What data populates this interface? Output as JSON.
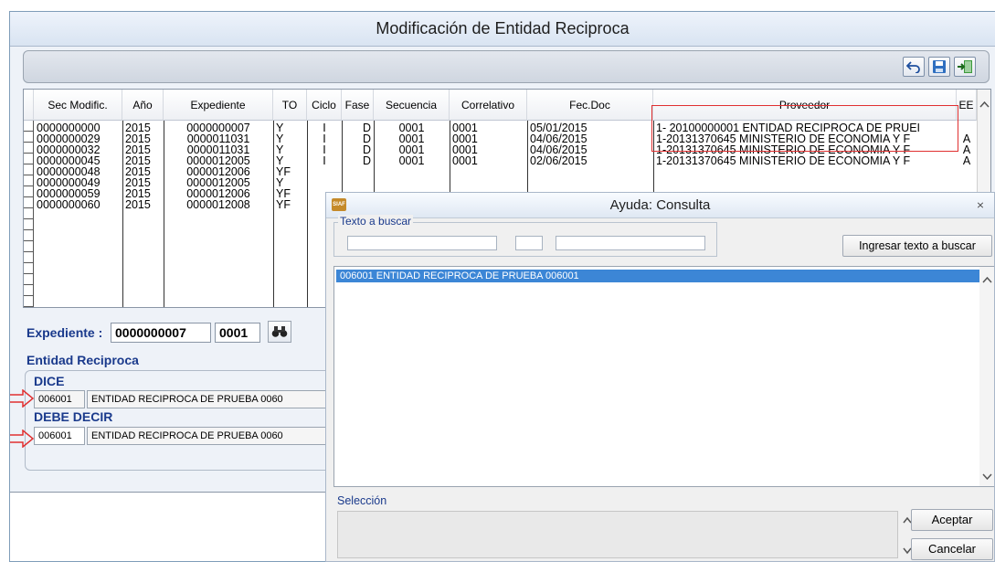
{
  "window": {
    "title": "Modificación de Entidad Reciproca"
  },
  "toolbar": {
    "undo_icon": "undo-icon",
    "save_icon": "save-icon",
    "exit_icon": "exit-icon"
  },
  "grid": {
    "columns": [
      "Sec Modific.",
      "Año",
      "Expediente",
      "TO",
      "Ciclo",
      "Fase",
      "Secuencia",
      "Correlativo",
      "Fec.Doc",
      "Proveedor",
      "EE"
    ],
    "rows": [
      [
        "0000000000",
        "2015",
        "0000000007",
        "Y",
        "I",
        "D",
        "0001",
        "0001",
        "05/01/2015",
        "1- 20100000001  ENTIDAD RECIPROCA DE PRUEI",
        ""
      ],
      [
        "0000000029",
        "2015",
        "0000011031",
        "Y",
        "I",
        "D",
        "0001",
        "0001",
        "04/06/2015",
        "1-20131370645 MINISTERIO DE ECONOMIA Y F",
        "A"
      ],
      [
        "0000000032",
        "2015",
        "0000011031",
        "Y",
        "I",
        "D",
        "0001",
        "0001",
        "04/06/2015",
        "1-20131370645 MINISTERIO DE ECONOMIA Y F",
        "A"
      ],
      [
        "0000000045",
        "2015",
        "0000012005",
        "Y",
        "I",
        "D",
        "0001",
        "0001",
        "02/06/2015",
        "1-20131370645 MINISTERIO DE ECONOMIA Y F",
        "A"
      ],
      [
        "0000000048",
        "2015",
        "0000012006",
        "YF",
        "",
        "",
        "",
        "",
        "",
        "",
        ""
      ],
      [
        "0000000049",
        "2015",
        "0000012005",
        "Y",
        "",
        "",
        "",
        "",
        "",
        "",
        ""
      ],
      [
        "0000000059",
        "2015",
        "0000012006",
        "YF",
        "",
        "",
        "",
        "",
        "",
        "",
        ""
      ],
      [
        "0000000060",
        "2015",
        "0000012008",
        "YF",
        "",
        "",
        "",
        "",
        "",
        "",
        ""
      ]
    ]
  },
  "form": {
    "expediente_label": "Expediente :",
    "expediente_value": "0000000007",
    "secuencia_value": "0001",
    "binoculars_icon": "binoculars-icon",
    "entidad_label": "Entidad Reciproca",
    "dice_label": "DICE",
    "dice_code": "006001",
    "dice_name": "ENTIDAD RECIPROCA DE PRUEBA 0060",
    "debe_label": "DEBE DECIR",
    "debe_code": "006001",
    "debe_name": "ENTIDAD RECIPROCA DE PRUEBA 0060"
  },
  "dialog": {
    "title": "Ayuda: Consulta",
    "logo_text": "SIAF",
    "close_glyph": "⨯",
    "search_legend": "Texto a buscar",
    "search_button": "Ingresar texto a buscar",
    "list_items": [
      "006001  ENTIDAD RECIPROCA DE PRUEBA 006001"
    ],
    "selection_label": "Selección",
    "accept_button": "Aceptar",
    "cancel_button": "Cancelar"
  },
  "colors": {
    "highlight_box": "#e03030",
    "selected_row": "#3c86d6",
    "label_blue": "#1a3a8c"
  }
}
